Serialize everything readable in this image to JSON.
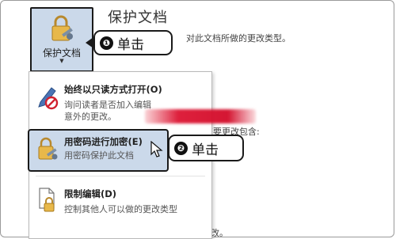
{
  "protect_button": {
    "label": "保护文档",
    "caret": "▼"
  },
  "heading": "保护文档",
  "description_top": "对此文档所做的更改类型。",
  "description_mid": "您要更改包含:",
  "description_bottom": "更改。",
  "callouts": [
    {
      "number": "❶",
      "text": "单击"
    },
    {
      "number": "❷",
      "text": "单击"
    }
  ],
  "menu": {
    "items": [
      {
        "title": "始终以只读方式打开(O)",
        "sub_lines": [
          "询问读者是否加入编辑",
          "意外的更改。"
        ],
        "icon": "pencil-no-icon"
      },
      {
        "title": "用密码进行加密(E)",
        "sub_lines": [
          "用密码保护此文档"
        ],
        "icon": "lock-key-icon"
      },
      {
        "title": "限制编辑(D)",
        "sub_lines": [
          "控制其他人可以做的更改类型"
        ],
        "icon": "document-lock-icon"
      }
    ]
  },
  "colors": {
    "highlight": "#cbd9ea",
    "accent_red": "#c8102e",
    "outline": "#1a1a1a"
  }
}
